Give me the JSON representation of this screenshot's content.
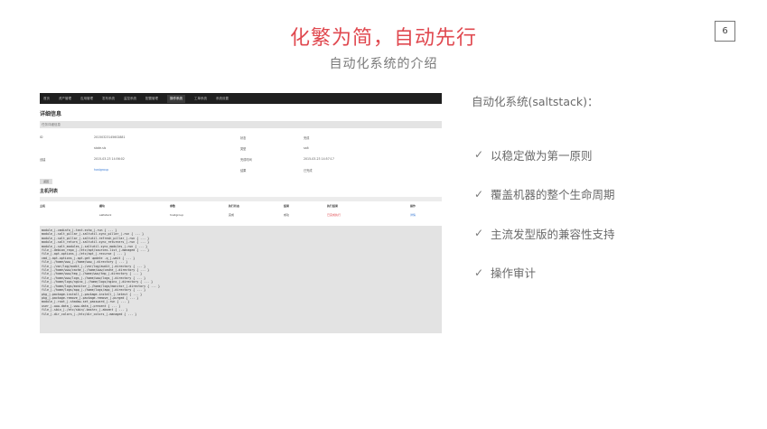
{
  "slide": {
    "title": "化繁为简，自动先行",
    "subtitle": "自动化系统的介绍",
    "page_number": "6"
  },
  "right": {
    "heading": "自动化系统(saltstack)：",
    "bullets": [
      {
        "check": "✓",
        "text": "以稳定做为第一原则"
      },
      {
        "check": "✓",
        "text": "覆盖机器的整个生命周期"
      },
      {
        "check": "✓",
        "text": "主流发型版的兼容性支持"
      },
      {
        "check": "✓",
        "text": "操作审计"
      }
    ]
  },
  "screenshot": {
    "nav": [
      "首页",
      "资产管理",
      "应用管理",
      "发布系统",
      "监控系统",
      "配置管理",
      "操作系统",
      "工单系统",
      "系统设置"
    ],
    "nav_active": 6,
    "page_title": "详细信息",
    "section_bar": "任务详细信息",
    "kv": [
      {
        "label": "ID",
        "value": "20150323145602881",
        "label2": "状态",
        "value2": "完成"
      },
      {
        "label": "",
        "value": "state.sls",
        "label2": "类型",
        "value2": "salt"
      },
      {
        "label": "创建",
        "value": "2015-03-23 14:56:02",
        "label2": "完成时间",
        "value2": "2015-03-23 14:57:17"
      },
      {
        "label": "",
        "value": "hostgroup",
        "label2": "结果",
        "value2": "已完成"
      }
    ],
    "back_button": "返回",
    "section2": "主机列表",
    "table_headers": [
      "主机",
      "模块",
      "参数",
      "执行状态",
      "结果",
      "执行结果",
      "操作"
    ],
    "table_row": [
      "",
      "saltstack",
      "hostgroup",
      "完成",
      "成功",
      "已完成执行",
      "详情"
    ],
    "log_lines": [
      "module_|-cmdinfo_|-test.echo_|-run  { ... }",
      "module_|-salt_pillar_|-saltutil.sync_pillar_|-run  { ... }",
      "module_|-salt_pillar_|-saltutil.refresh_pillar_|-run  { ... }",
      "module_|-salt_return_|-saltutil.sync_returners_|-run  { ... }",
      "module_|-salt_modules_|-saltutil.sync_modules_|-run  { ... }",
      "file_|-debian_repo_|-/etc/apt/sources.list_|-managed  { ... }",
      "file_|-apt-options_|-/etc/apt_|-recurse  { ... }",
      "cmd_|-apt-options_|-apt-get update -q_|-wait  { ... }",
      "file_|-/home/www_|-/home/www_|-directory  { ... }",
      "file_|-/var/log/audit_|-/var/log/audit_|-directory  { ... }",
      "file_|-/home/www/cache_|-/home/www/cache_|-directory  { ... }",
      "file_|-/home/www/tmp_|-/home/www/tmp_|-directory  { ... }",
      "file_|-/home/www/logs_|-/home/www/logs_|-directory  { ... }",
      "file_|-/home/logs/nginx_|-/home/logs/nginx_|-directory  { ... }",
      "file_|-/home/logs/monitor_|-/home/logs/monitor_|-directory  { ... }",
      "file_|-/home/logs/app_|-/home/logs/app_|-directory  { ... }",
      "pkg_|-package.install_|-package.install_|-latest  { ... }",
      "pkg_|-package.remove_|-package.remove_|-purged  { ... }",
      "module_|-root_|-shadow.set_password_|-run  { ... }",
      "user_|-www-data_|-www-data_|-present  { ... }",
      "file_|-sbin_|-/etc/sbin/.bashrc_|-absent  { ... }",
      "file_|-dir_colors_|-/etc/dir_colors_|-managed  { ... }"
    ]
  }
}
